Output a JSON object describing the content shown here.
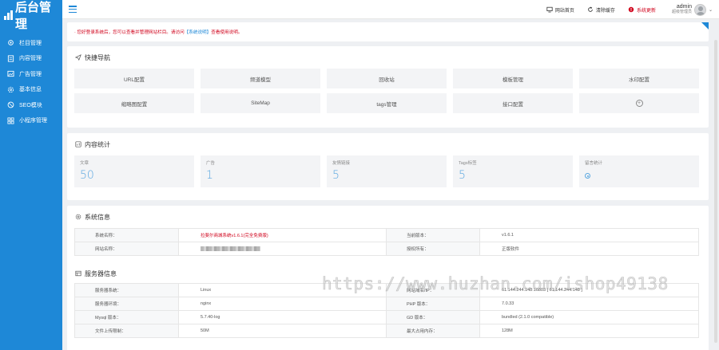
{
  "brand": {
    "title": "后台管理"
  },
  "sidebar": {
    "items": [
      {
        "label": "栏目管理",
        "icon": "gear-icon"
      },
      {
        "label": "内容管理",
        "icon": "document-icon"
      },
      {
        "label": "广告管理",
        "icon": "image-icon"
      },
      {
        "label": "基本信息",
        "icon": "settings-icon"
      },
      {
        "label": "SEO模块",
        "icon": "seo-icon"
      },
      {
        "label": "小程序管理",
        "icon": "grid-icon"
      }
    ]
  },
  "topbar": {
    "home": "网站首页",
    "clear_cache": "清除缓存",
    "system_update": "系统更新",
    "user_name": "admin",
    "user_role": "超级管理员"
  },
  "notice": {
    "text_before": "· 您好登录系统后，您可以查看并管理网站栏目。请访问",
    "link": "【系统说明】",
    "text_after": "查看使用说明。"
  },
  "quick": {
    "title": "快捷导航",
    "items": [
      "URL配置",
      "频道模型",
      "回收站",
      "模板管理",
      "水印配置",
      "缩略图配置",
      "SiteMap",
      "tags管理",
      "接口配置"
    ]
  },
  "stats": {
    "title": "内容统计",
    "items": [
      {
        "label": "文章",
        "value": "50"
      },
      {
        "label": "广告",
        "value": "1"
      },
      {
        "label": "友情链接",
        "value": "5"
      },
      {
        "label": "Tags标签",
        "value": "5"
      },
      {
        "label": "留言统计",
        "value": ""
      }
    ]
  },
  "system": {
    "title": "系统信息",
    "rows": [
      {
        "k1": "系统名称：",
        "v1": "拉斐尔商城系统v1.6.1(完全免费版)",
        "k2": "当前版本：",
        "v2": "v1.6.1"
      },
      {
        "k1": "网站名称：",
        "v1": "",
        "k2": "授权所有：",
        "v2": "正版软件"
      }
    ]
  },
  "server": {
    "title": "服务器信息",
    "rows": [
      {
        "k1": "服务器系统：",
        "v1": "Linux",
        "k2": "网站域名/IP：",
        "v2": "61.144.244.148:16803 [ 61.144.244.148 ]"
      },
      {
        "k1": "服务器环境：",
        "v1": "nginx",
        "k2": "PHP 版本：",
        "v2": "7.0.33"
      },
      {
        "k1": "Mysql 版本：",
        "v1": "5.7.40-log",
        "k2": "GD 版本：",
        "v2": "bundled (2.1.0 compatible)"
      },
      {
        "k1": "文件上传限制：",
        "v1": "50M",
        "k2": "最大占用内存：",
        "v2": "128M"
      }
    ]
  },
  "watermark": "https://www.huzhan.com/ishop49138",
  "colors": {
    "primary": "#1e88d7",
    "alert": "#d0021b",
    "stat_value": "#5aa7e0"
  }
}
